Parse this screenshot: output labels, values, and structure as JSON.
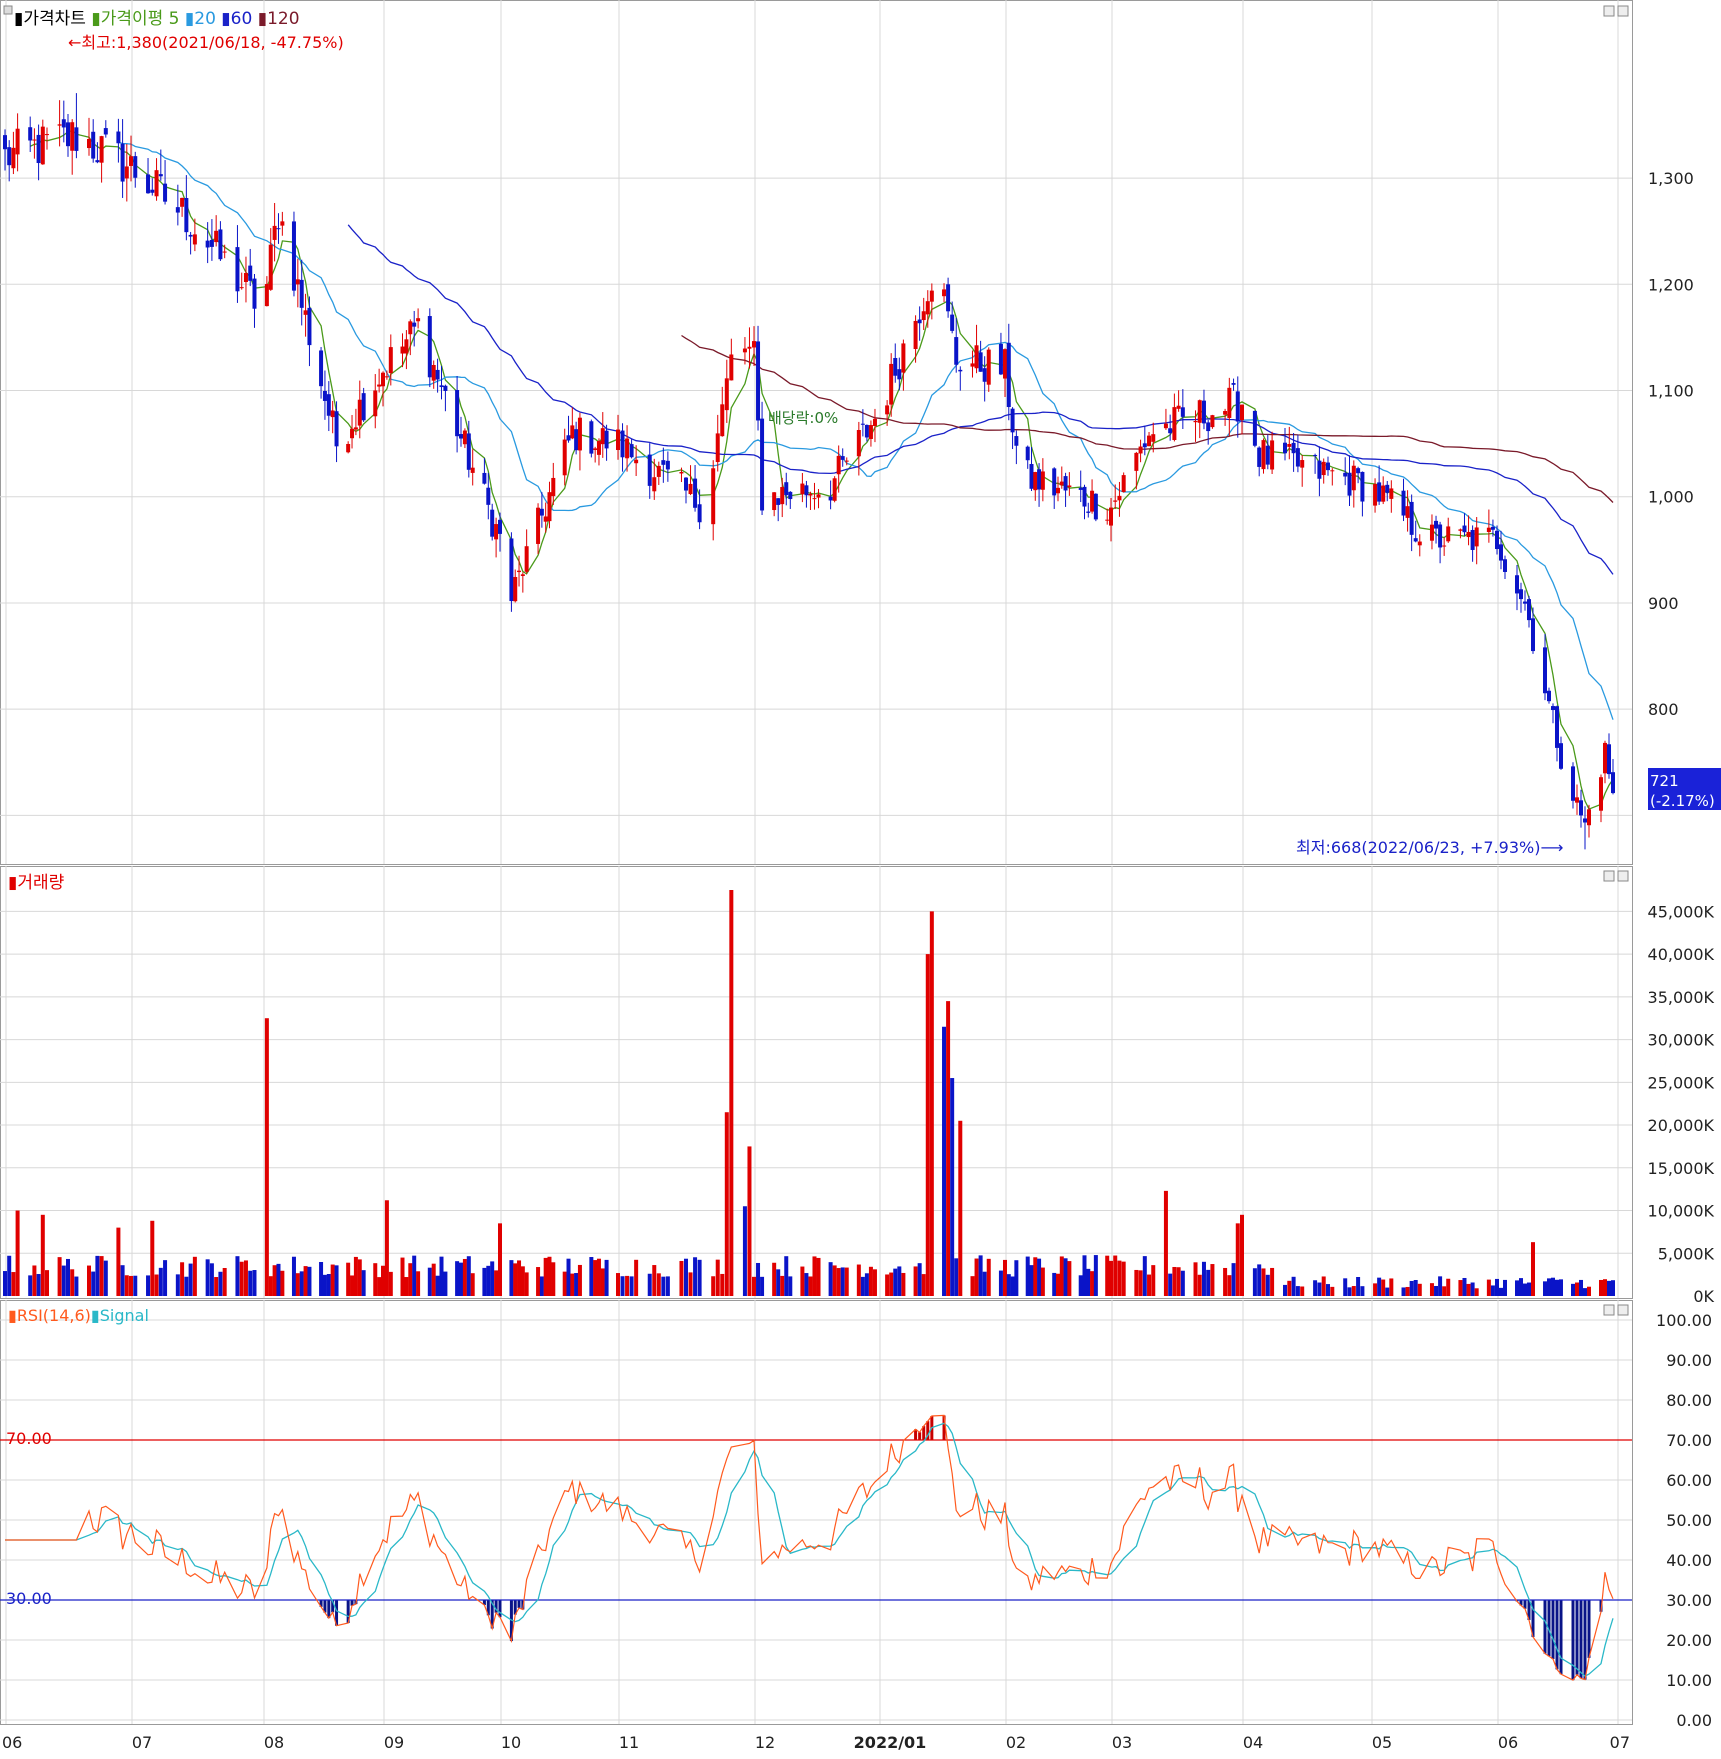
{
  "colors": {
    "up": "#e00000",
    "down": "#0a14c8",
    "ma5": "#4a9a1a",
    "ma20": "#2a9ae0",
    "ma60": "#1a22c8",
    "ma120": "#7a1a2a",
    "grid": "#d8d8d8",
    "rsi": "#ff5a1e",
    "signal": "#2ab8c8",
    "price_badge_bg": "#1a22d8"
  },
  "price_panel": {
    "legend": {
      "chart_name": "가격차트",
      "ma_label": "가격이평",
      "ma_periods": [
        "5",
        "20",
        "60",
        "120"
      ]
    },
    "high_annotation": "←최고:1,380(2021/06/18, -47.75%)",
    "low_annotation": "최저:668(2022/06/23, +7.93%)⟶",
    "dividend_annotation": "배당락:0%",
    "current_price": "721",
    "current_change": "(-2.17%)"
  },
  "volume_panel": {
    "legend": "거래량"
  },
  "rsi_panel": {
    "legend_rsi": "RSI(14,6)",
    "legend_signal": "Signal",
    "line_70_label": "70.00",
    "line_30_label": "30.00"
  },
  "x_axis": {
    "months": [
      "06",
      "07",
      "08",
      "09",
      "10",
      "11",
      "12",
      "2022/01",
      "02",
      "03",
      "04",
      "05",
      "06",
      "07"
    ]
  },
  "chart_data": [
    {
      "type": "candlestick",
      "title": "가격차트",
      "y_ticks": [
        "1,300",
        "1,200",
        "1,100",
        "1,000",
        "900",
        "800"
      ],
      "ylim": [
        658,
        1430
      ],
      "moving_averages": [
        "5",
        "20",
        "60",
        "120"
      ],
      "max_point": {
        "value": 1380,
        "date": "2021/06/18"
      },
      "min_point": {
        "value": 668,
        "date": "2022/06/23"
      },
      "last": {
        "value": 721,
        "change_pct": "-2.17%"
      },
      "anchors": [
        [
          "2021/06/01",
          1320
        ],
        [
          "2021/06/18",
          1340
        ],
        [
          "2021/07/01",
          1310
        ],
        [
          "2021/07/15",
          1260
        ],
        [
          "2021/08/01",
          1175
        ],
        [
          "2021/08/05",
          1270
        ],
        [
          "2021/08/20",
          1050
        ],
        [
          "2021/09/01",
          1120
        ],
        [
          "2021/09/10",
          1160
        ],
        [
          "2021/10/01",
          960
        ],
        [
          "2021/10/04",
          905
        ],
        [
          "2021/10/20",
          1060
        ],
        [
          "2021/11/01",
          1050
        ],
        [
          "2021/11/20",
          990
        ],
        [
          "2021/11/27",
          1150
        ],
        [
          "2021/12/01",
          1130
        ],
        [
          "2021/12/03",
          1000
        ],
        [
          "2021/12/20",
          1010
        ],
        [
          "2022/01/01",
          1080
        ],
        [
          "2022/01/15",
          1220
        ],
        [
          "2022/01/20",
          1130
        ],
        [
          "2022/02/01",
          1120
        ],
        [
          "2022/02/05",
          1020
        ],
        [
          "2022/03/01",
          990
        ],
        [
          "2022/03/10",
          1060
        ],
        [
          "2022/04/01",
          1090
        ],
        [
          "2022/04/05",
          1040
        ],
        [
          "2022/05/01",
          1010
        ],
        [
          "2022/05/15",
          960
        ],
        [
          "2022/06/01",
          960
        ],
        [
          "2022/06/08",
          900
        ],
        [
          "2022/06/18",
          740
        ],
        [
          "2022/06/23",
          690
        ],
        [
          "2022/06/28",
          760
        ],
        [
          "2022/06/30",
          721
        ]
      ]
    },
    {
      "type": "bar",
      "title": "거래량",
      "y_ticks": [
        "45,000K",
        "40,000K",
        "35,000K",
        "30,000K",
        "25,000K",
        "20,000K",
        "15,000K",
        "10,000K",
        "5,000K",
        "0K"
      ],
      "ylim": [
        0,
        47500
      ],
      "spikes": [
        [
          "2021/06/04",
          10000,
          "up"
        ],
        [
          "2021/06/10",
          9500,
          "up"
        ],
        [
          "2021/06/28",
          8000,
          "up"
        ],
        [
          "2021/07/06",
          8800,
          "up"
        ],
        [
          "2021/08/02",
          32500,
          "up"
        ],
        [
          "2021/09/02",
          11200,
          "up"
        ],
        [
          "2021/10/01",
          8500,
          "up"
        ],
        [
          "2021/11/25",
          21500,
          "up"
        ],
        [
          "2021/11/26",
          47500,
          "up"
        ],
        [
          "2021/11/29",
          10500,
          "down"
        ],
        [
          "2021/11/30",
          17500,
          "up"
        ],
        [
          "2022/01/13",
          40000,
          "up"
        ],
        [
          "2022/01/14",
          45000,
          "up"
        ],
        [
          "2022/01/17",
          31500,
          "down"
        ],
        [
          "2022/01/18",
          34500,
          "up"
        ],
        [
          "2022/01/19",
          25500,
          "down"
        ],
        [
          "2022/01/21",
          20500,
          "up"
        ],
        [
          "2022/03/14",
          12300,
          "up"
        ],
        [
          "2022/03/31",
          8500,
          "up"
        ],
        [
          "2022/04/01",
          9500,
          "up"
        ],
        [
          "2022/06/10",
          6300,
          "up"
        ]
      ]
    },
    {
      "type": "line",
      "title": "RSI(14,6)",
      "y_ticks": [
        "100.00",
        "90.00",
        "80.00",
        "70.00",
        "60.00",
        "50.00",
        "40.00",
        "30.00",
        "20.00",
        "10.00",
        "0.00"
      ],
      "ylim": [
        0,
        100
      ],
      "series": [
        {
          "name": "RSI(14,6)"
        },
        {
          "name": "Signal"
        }
      ],
      "reference_lines": [
        70,
        30
      ]
    }
  ]
}
